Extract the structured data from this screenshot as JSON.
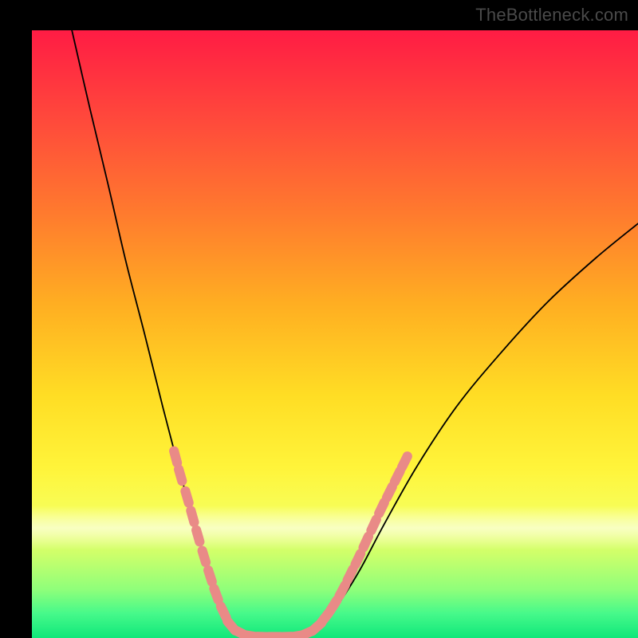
{
  "watermark": "TheBottleneck.com",
  "chart_data": {
    "type": "line",
    "title": "",
    "xlabel": "",
    "ylabel": "",
    "xlim": [
      0,
      1
    ],
    "ylim": [
      0,
      1
    ],
    "grid": false,
    "legend": false,
    "curves": [
      {
        "name": "left-branch",
        "x": [
          0.066,
          0.096,
          0.126,
          0.155,
          0.186,
          0.216,
          0.245,
          0.276,
          0.3,
          0.32,
          0.34,
          0.36
        ],
        "y": [
          1.0,
          0.87,
          0.745,
          0.62,
          0.5,
          0.38,
          0.27,
          0.16,
          0.078,
          0.034,
          0.01,
          0.002
        ]
      },
      {
        "name": "valley-floor",
        "x": [
          0.36,
          0.38,
          0.4,
          0.42,
          0.44
        ],
        "y": [
          0.002,
          0.001,
          0.001,
          0.001,
          0.002
        ]
      },
      {
        "name": "right-branch",
        "x": [
          0.44,
          0.47,
          0.5,
          0.54,
          0.58,
          0.635,
          0.7,
          0.77,
          0.85,
          0.93,
          1.0
        ],
        "y": [
          0.002,
          0.016,
          0.048,
          0.11,
          0.185,
          0.282,
          0.38,
          0.465,
          0.552,
          0.625,
          0.682
        ]
      }
    ],
    "markers": {
      "name": "highlight-beads",
      "color": "#e98a87",
      "points": [
        {
          "x": 0.237,
          "y": 0.298
        },
        {
          "x": 0.245,
          "y": 0.268
        },
        {
          "x": 0.256,
          "y": 0.232
        },
        {
          "x": 0.265,
          "y": 0.2
        },
        {
          "x": 0.274,
          "y": 0.168
        },
        {
          "x": 0.284,
          "y": 0.134
        },
        {
          "x": 0.294,
          "y": 0.102
        },
        {
          "x": 0.304,
          "y": 0.072
        },
        {
          "x": 0.316,
          "y": 0.043
        },
        {
          "x": 0.329,
          "y": 0.02
        },
        {
          "x": 0.345,
          "y": 0.008
        },
        {
          "x": 0.363,
          "y": 0.003
        },
        {
          "x": 0.382,
          "y": 0.002
        },
        {
          "x": 0.4,
          "y": 0.002
        },
        {
          "x": 0.418,
          "y": 0.002
        },
        {
          "x": 0.436,
          "y": 0.003
        },
        {
          "x": 0.454,
          "y": 0.008
        },
        {
          "x": 0.47,
          "y": 0.018
        },
        {
          "x": 0.484,
          "y": 0.034
        },
        {
          "x": 0.498,
          "y": 0.054
        },
        {
          "x": 0.512,
          "y": 0.078
        },
        {
          "x": 0.525,
          "y": 0.104
        },
        {
          "x": 0.538,
          "y": 0.13
        },
        {
          "x": 0.551,
          "y": 0.158
        },
        {
          "x": 0.564,
          "y": 0.186
        },
        {
          "x": 0.577,
          "y": 0.214
        },
        {
          "x": 0.59,
          "y": 0.24
        },
        {
          "x": 0.603,
          "y": 0.266
        },
        {
          "x": 0.615,
          "y": 0.29
        }
      ]
    },
    "band": {
      "center_y": 0.182,
      "half_height": 0.037
    }
  }
}
